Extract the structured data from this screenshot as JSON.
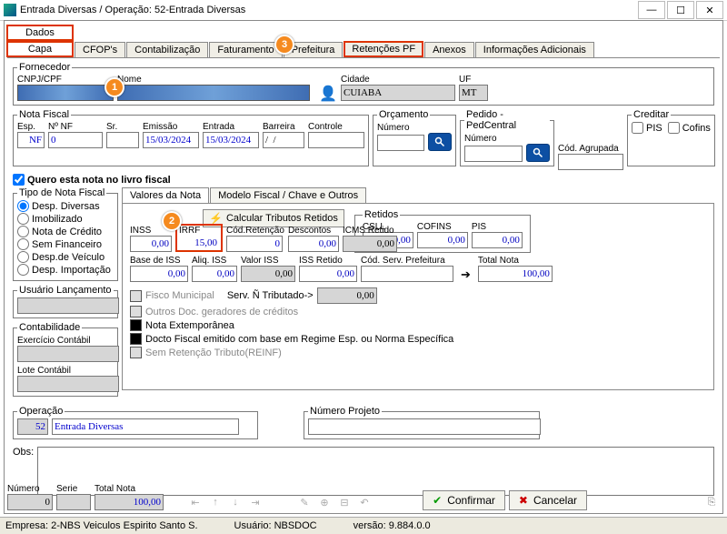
{
  "window": {
    "title": "Entrada Diversas / Operação: 52-Entrada Diversas"
  },
  "tabRow1": {
    "dados": "Dados"
  },
  "tabRow2": {
    "capa": "Capa",
    "cfops": "CFOP's",
    "contab": "Contabilização",
    "fat": "Faturamento",
    "pref": "Prefeitura",
    "ret": "Retenções PF",
    "anexos": "Anexos",
    "info": "Informações Adicionais"
  },
  "fornecedor": {
    "legend": "Fornecedor",
    "cnpj_lbl": "CNPJ/CPF",
    "nome_lbl": "Nome",
    "cidade_lbl": "Cidade",
    "cidade": "CUIABA",
    "uf_lbl": "UF",
    "uf": "MT"
  },
  "nf": {
    "legend": "Nota Fiscal",
    "esp_lbl": "Esp.",
    "esp": "NF",
    "nnf_lbl": "Nº NF",
    "nnf": "0",
    "sr_lbl": "Sr.",
    "sr": "",
    "emissao_lbl": "Emissão",
    "emissao": "15/03/2024",
    "entrada_lbl": "Entrada",
    "entrada": "15/03/2024",
    "barreira_lbl": "Barreira",
    "barreira": "/  /",
    "controle_lbl": "Controle",
    "controle": ""
  },
  "orc": {
    "legend": "Orçamento",
    "num_lbl": "Número",
    "num": ""
  },
  "ped": {
    "legend": "Pedido - PedCentral",
    "num_lbl": "Número",
    "num": ""
  },
  "agr": {
    "lbl": "Cód. Agrupada"
  },
  "creditar": {
    "legend": "Creditar",
    "pis": "PIS",
    "cofins": "Cofins"
  },
  "livro": {
    "label": "Quero esta nota no livro fiscal"
  },
  "tiponota": {
    "legend": "Tipo de Nota Fiscal",
    "r1": "Desp. Diversas",
    "r2": "Imobilizado",
    "r3": "Nota de Crédito",
    "r4": "Sem Financeiro",
    "r5": "Desp.de Veículo",
    "r6": "Desp. Importação"
  },
  "usu": {
    "legend": "Usuário Lançamento"
  },
  "cont": {
    "legend": "Contabilidade",
    "ex_lbl": "Exercício Contábil",
    "lote_lbl": "Lote Contábil"
  },
  "subtab": {
    "valores": "Valores da Nota",
    "modelo": "Modelo Fiscal / Chave e Outros"
  },
  "calcbtn": "Calcular Tributos Retidos",
  "vals": {
    "inss_lbl": "INSS",
    "inss": "0,00",
    "irrf_lbl": "IRRF",
    "irrf": "15,00",
    "codret_lbl": "Cód.Retenção",
    "codret": "0",
    "desc_lbl": "Descontos",
    "desc": "0,00",
    "icmsr_lbl": "ICMS Retido",
    "icmsr": "0,00",
    "retidos_legend": "Retidos",
    "csll_lbl": "CSLL",
    "csll": "0,00",
    "cofins_lbl": "COFINS",
    "cofins": "0,00",
    "pis_lbl": "PIS",
    "pis": "0,00",
    "baseiss_lbl": "Base de ISS",
    "baseiss": "0,00",
    "aliqiss_lbl": "Aliq. ISS",
    "aliqiss": "0,00",
    "valoriss_lbl": "Valor ISS",
    "valoriss": "0,00",
    "issret_lbl": "ISS Retido",
    "issret": "0,00",
    "codserv_lbl": "Cód. Serv. Prefeitura",
    "codserv": "",
    "totalnota_lbl": "Total Nota",
    "totalnota": "100,00"
  },
  "checks": {
    "fisco": "Fisco Municipal",
    "servnt": "Serv. Ñ Tributado->",
    "servnt_v": "0,00",
    "outros": "Outros Doc. geradores de créditos",
    "extemp": "Nota Extemporânea",
    "docto": "Docto Fiscal emitido com base em Regime Esp. ou Norma Específica",
    "semret": "Sem Retenção Tributo(REINF)"
  },
  "oper": {
    "legend": "Operação",
    "cod": "52",
    "desc": "Entrada Diversas"
  },
  "proj": {
    "legend": "Número Projeto"
  },
  "obs": {
    "lbl": "Obs:"
  },
  "footer": {
    "num_lbl": "Número",
    "num": "0",
    "serie_lbl": "Serie",
    "serie": "",
    "tot_lbl": "Total Nota",
    "tot": "100,00",
    "confirmar": "Confirmar",
    "cancelar": "Cancelar"
  },
  "status": {
    "empresa": "Empresa: 2-NBS Veiculos Espirito Santo S.",
    "usuario": "Usuário: NBSDOC",
    "versao": "versão: 9.884.0.0"
  }
}
